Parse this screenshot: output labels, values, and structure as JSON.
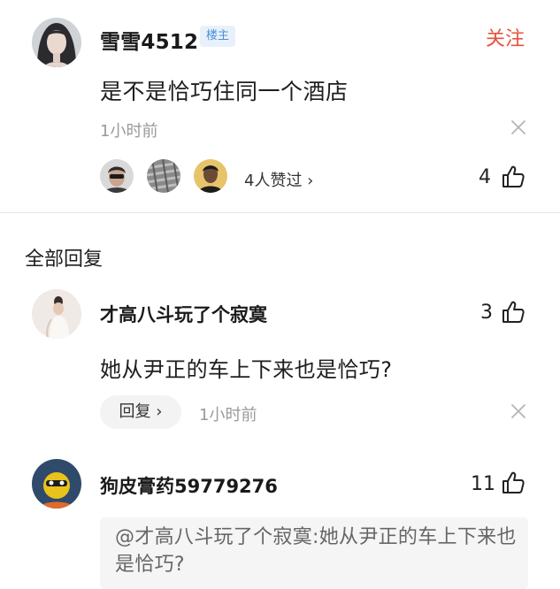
{
  "post": {
    "author": "雪雪4512",
    "badge": "楼主",
    "follow_label": "关注",
    "text": "是不是恰巧住同一个酒店",
    "time": "1小时前",
    "likers_text": "4人赞过 ›",
    "like_count": "4"
  },
  "section_title": "全部回复",
  "replies": [
    {
      "author": "才高八斗玩了个寂寞",
      "like_count": "3",
      "text": "她从尹正的车上下来也是恰巧?",
      "reply_button": "回复 ›",
      "time": "1小时前"
    },
    {
      "author": "狗皮膏药59779276",
      "like_count": "11",
      "quote": "@才高八斗玩了个寂寞:她从尹正的车上下来也是恰巧?"
    }
  ],
  "icons": {
    "close": "close-icon",
    "thumb": "thumbs-up-icon"
  },
  "colors": {
    "follow": "#e5533d",
    "badge_bg": "#e8f1fb",
    "badge_text": "#4a8fd6",
    "muted": "#9a9a9a"
  }
}
